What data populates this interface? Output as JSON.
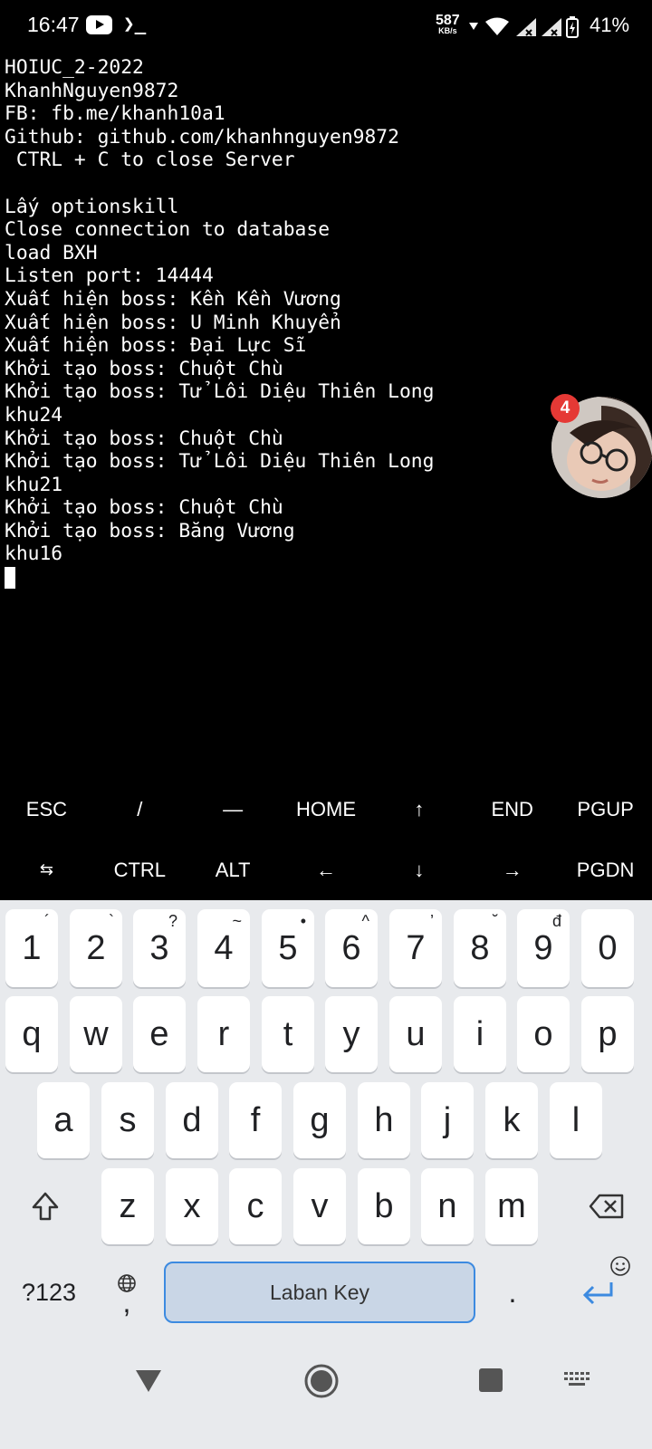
{
  "status_bar": {
    "time": "16:47",
    "youtube_icon": "youtube-icon",
    "terminal_icon": "❯_",
    "net_speed_value": "587",
    "net_speed_unit": "KB/s",
    "battery_percent": "41%"
  },
  "terminal": {
    "lines": [
      "HOIUC_2-2022",
      "KhanhNguyen9872",
      "FB: fb.me/khanh10a1",
      "Github: github.com/khanhnguyen9872",
      " CTRL + C to close Server",
      "",
      "Lấy optionskill",
      "Close connection to database",
      "load BXH",
      "Listen port: 14444",
      "Xuất hiện boss: Kền Kền Vương",
      "Xuất hiện boss: U Minh Khuyển",
      "Xuất hiện boss: Đại Lực Sĩ",
      "Khởi tạo boss: Chuột Chù",
      "Khởi tạo boss: Tử Lôi Diệu Thiên Long",
      "khu24",
      "Khởi tạo boss: Chuột Chù",
      "Khởi tạo boss: Tử Lôi Diệu Thiên Long",
      "khu21",
      "Khởi tạo boss: Chuột Chù",
      "Khởi tạo boss: Băng Vương",
      "khu16"
    ]
  },
  "chat_head": {
    "badge_count": "4"
  },
  "extra_keys": {
    "row1": [
      "ESC",
      "/",
      "—",
      "HOME",
      "↑",
      "END",
      "PGUP"
    ],
    "row2": [
      "⇆",
      "CTRL",
      "ALT",
      "←",
      "↓",
      "→",
      "PGDN"
    ]
  },
  "keyboard": {
    "numbers": [
      "1",
      "2",
      "3",
      "4",
      "5",
      "6",
      "7",
      "8",
      "9",
      "0"
    ],
    "number_hints": [
      "´",
      "`",
      "?",
      "~",
      "•",
      "^",
      "’",
      "˘",
      "đ",
      ""
    ],
    "row_q": [
      "q",
      "w",
      "e",
      "r",
      "t",
      "y",
      "u",
      "i",
      "o",
      "p"
    ],
    "row_a": [
      "a",
      "s",
      "d",
      "f",
      "g",
      "h",
      "j",
      "k",
      "l"
    ],
    "row_z": [
      "z",
      "x",
      "c",
      "v",
      "b",
      "n",
      "m"
    ],
    "symbols_label": "?123",
    "comma": ",",
    "period": ".",
    "space_label": "Laban Key"
  },
  "colors": {
    "terminal_bg": "#000000",
    "terminal_fg": "#ffffff",
    "keyboard_bg": "#e8eaed",
    "space_border": "#3c8ae0",
    "badge": "#e53935"
  }
}
